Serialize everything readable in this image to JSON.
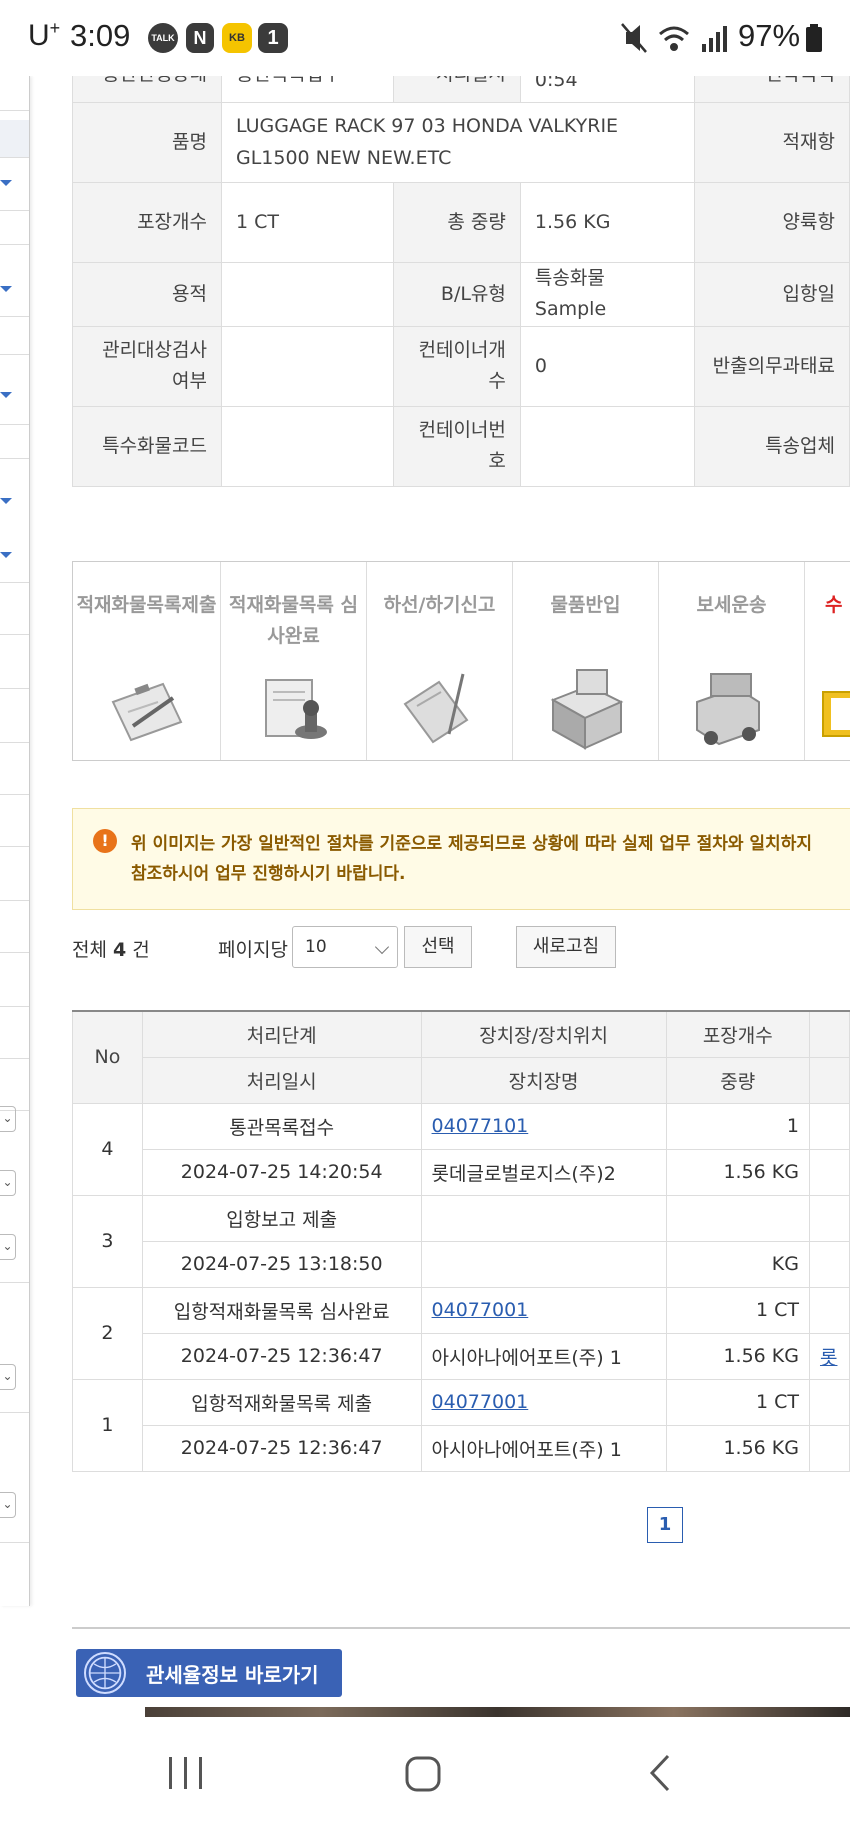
{
  "status_bar": {
    "carrier": "U",
    "carrier_sup": "+",
    "time": "3:09",
    "notif_talk": "TALK",
    "notif_n": "N",
    "notif_kb": "KB",
    "notif_one": "1",
    "battery": "97%"
  },
  "info_rows": [
    {
      "h1": "통관진행상태",
      "v1": "통관목록접수",
      "h2": "처리일시",
      "v2": "0:54",
      "h3": "선박국적"
    },
    {
      "h1": "품명",
      "v1": "LUGGAGE RACK 97 03 HONDA VALKYRIE GL1500 NEW NEW.ETC",
      "h3": "적재항"
    },
    {
      "h1": "포장개수",
      "v1": "1 CT",
      "h2": "총 중량",
      "v2": "1.56 KG",
      "h3": "양륙항"
    },
    {
      "h1": "용적",
      "v1": "",
      "h2": "B/L유형",
      "v2": "특송화물 Sample",
      "h3": "입항일"
    },
    {
      "h1": "관리대상검사여부",
      "v1": "",
      "h2": "컨테이너개수",
      "v2": "0",
      "h3": "반출의무과태료"
    },
    {
      "h1": "특수화물코드",
      "v1": "",
      "h2": "컨테이너번호",
      "v2": "",
      "h3": "특송업체"
    }
  ],
  "process_steps": [
    {
      "label": "적재화물목록제출"
    },
    {
      "label": "적재화물목록 심사완료"
    },
    {
      "label": "하선/하기신고"
    },
    {
      "label": "물품반입"
    },
    {
      "label": "보세운송"
    },
    {
      "label": "수"
    }
  ],
  "notice": {
    "icon": "!",
    "line1": "위 이미지는 가장 일반적인 절차를 기준으로 제공되므로 상황에 따라 실제 업무 절차와 일치하지",
    "line2": "참조하시어 업무 진행하시기 바랍니다."
  },
  "list_controls": {
    "total_prefix": "전체",
    "total_count": "4",
    "total_suffix": "건",
    "per_page_label": "페이지당",
    "per_page_value": "10",
    "select_button": "선택",
    "refresh_button": "새로고침"
  },
  "history": {
    "headers": {
      "no": "No",
      "stage": "처리단계",
      "datetime": "처리일시",
      "location": "장치장/장치위치",
      "location_name": "장치장명",
      "packages": "포장개수",
      "weight": "중량"
    },
    "rows": [
      {
        "no": "4",
        "stage": "통관목록접수",
        "datetime": "2024-07-25 14:20:54",
        "location_code": "04077101",
        "location_name": "롯데글로벌로지스(주)2",
        "packages": "1",
        "weight": "1.56 KG",
        "extra": ""
      },
      {
        "no": "3",
        "stage": "입항보고 제출",
        "datetime": "2024-07-25 13:18:50",
        "location_code": "",
        "location_name": "",
        "packages": "",
        "weight": "KG",
        "extra": ""
      },
      {
        "no": "2",
        "stage": "입항적재화물목록 심사완료",
        "datetime": "2024-07-25 12:36:47",
        "location_code": "04077001",
        "location_name": "아시아나에어포트(주) 1",
        "packages": "1 CT",
        "weight": "1.56 KG",
        "extra": "롯"
      },
      {
        "no": "1",
        "stage": "입항적재화물목록 제출",
        "datetime": "2024-07-25 12:36:47",
        "location_code": "04077001",
        "location_name": "아시아나에어포트(주) 1",
        "packages": "1 CT",
        "weight": "1.56 KG",
        "extra": ""
      }
    ]
  },
  "pagination": {
    "current": "1"
  },
  "banner": {
    "text": "관세율정보 바로가기"
  },
  "colors": {
    "link": "#2a5db0",
    "notice_bg": "#fffbe6",
    "banner": "#3a62b5",
    "header_bg": "#f3f3f3"
  }
}
